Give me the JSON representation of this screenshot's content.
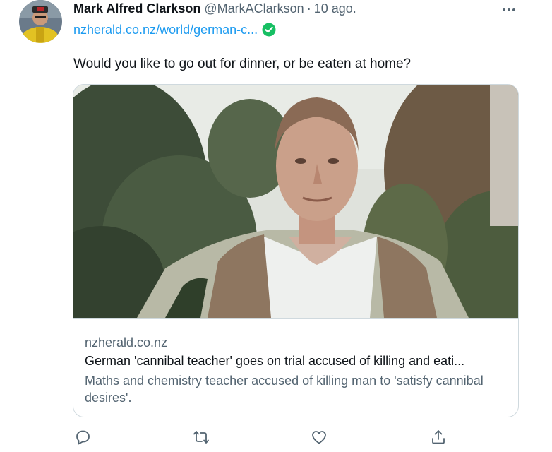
{
  "tweet": {
    "author": {
      "display_name": "Mark Alfred Clarkson",
      "handle": "@MarkAClarkson",
      "separator": "·",
      "date": "10 ago."
    },
    "link_text": "nzherald.co.nz/world/german-c...",
    "text": "Would you like to go out for dinner, or be eaten at home?",
    "card": {
      "domain": "nzherald.co.nz",
      "title": "German 'cannibal teacher' goes on trial accused of killing and eati...",
      "description": "Maths and chemistry teacher accused of killing man to 'satisfy cannibal desires'."
    },
    "actions": [
      "reply-icon",
      "retweet-icon",
      "like-icon",
      "share-icon"
    ]
  },
  "colors": {
    "link": "#1d9bf0",
    "secondary_text": "#536471",
    "primary_text": "#0f1419",
    "border": "#cfd9de"
  }
}
